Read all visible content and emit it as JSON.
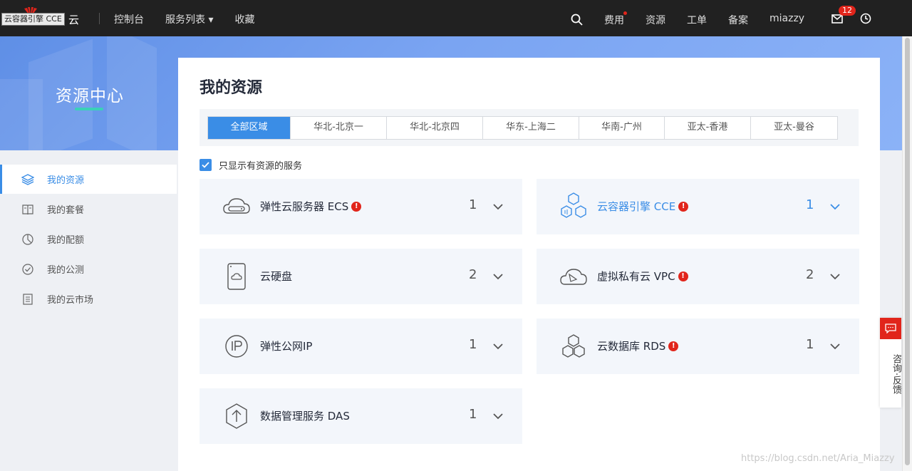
{
  "topbar": {
    "logo_text": "云",
    "tooltip": "云容器引擎 CCE",
    "nav": [
      "控制台",
      "服务列表 ▾",
      "收藏"
    ],
    "fee": "费用",
    "resource": "资源",
    "ticket": "工单",
    "filing": "备案",
    "user": "miazzy",
    "mail_badge": "12"
  },
  "banner": {
    "title": "资源中心"
  },
  "sidebar": {
    "items": [
      {
        "label": "我的资源",
        "icon": "layers-icon",
        "active": true
      },
      {
        "label": "我的套餐",
        "icon": "book-icon",
        "active": false
      },
      {
        "label": "我的配额",
        "icon": "pie-icon",
        "active": false
      },
      {
        "label": "我的公测",
        "icon": "check-circle-icon",
        "active": false
      },
      {
        "label": "我的云市场",
        "icon": "document-icon",
        "active": false
      }
    ]
  },
  "main": {
    "title": "我的资源",
    "regions": [
      "全部区域",
      "华北-北京一",
      "华北-北京四",
      "华东-上海二",
      "华南-广州",
      "亚太-香港",
      "亚太-曼谷"
    ],
    "active_region": "全部区域",
    "filter_label": "只显示有资源的服务",
    "filter_checked": true,
    "cards": [
      {
        "name": "弹性云服务器 ECS",
        "count": "1",
        "warn": true,
        "icon": "cloud-server-icon",
        "highlight": false
      },
      {
        "name": "云容器引擎 CCE",
        "count": "1",
        "warn": true,
        "icon": "container-icon",
        "highlight": true
      },
      {
        "name": "云硬盘",
        "count": "2",
        "warn": false,
        "icon": "disk-icon",
        "highlight": false
      },
      {
        "name": "虚拟私有云 VPC",
        "count": "2",
        "warn": true,
        "icon": "vpc-cloud-icon",
        "highlight": false
      },
      {
        "name": "弹性公网IP",
        "count": "1",
        "warn": false,
        "icon": "ip-icon",
        "highlight": false
      },
      {
        "name": "云数据库 RDS",
        "count": "1",
        "warn": true,
        "icon": "database-icon",
        "highlight": false
      },
      {
        "name": "数据管理服务 DAS",
        "count": "1",
        "warn": false,
        "icon": "das-icon",
        "highlight": false
      }
    ]
  },
  "consult": {
    "label": "咨询·反馈"
  },
  "watermark": "https://blog.csdn.net/Aria_Miazzy",
  "colors": {
    "accent": "#3a8de6",
    "alert": "#e1251b",
    "topbar": "#212121"
  }
}
